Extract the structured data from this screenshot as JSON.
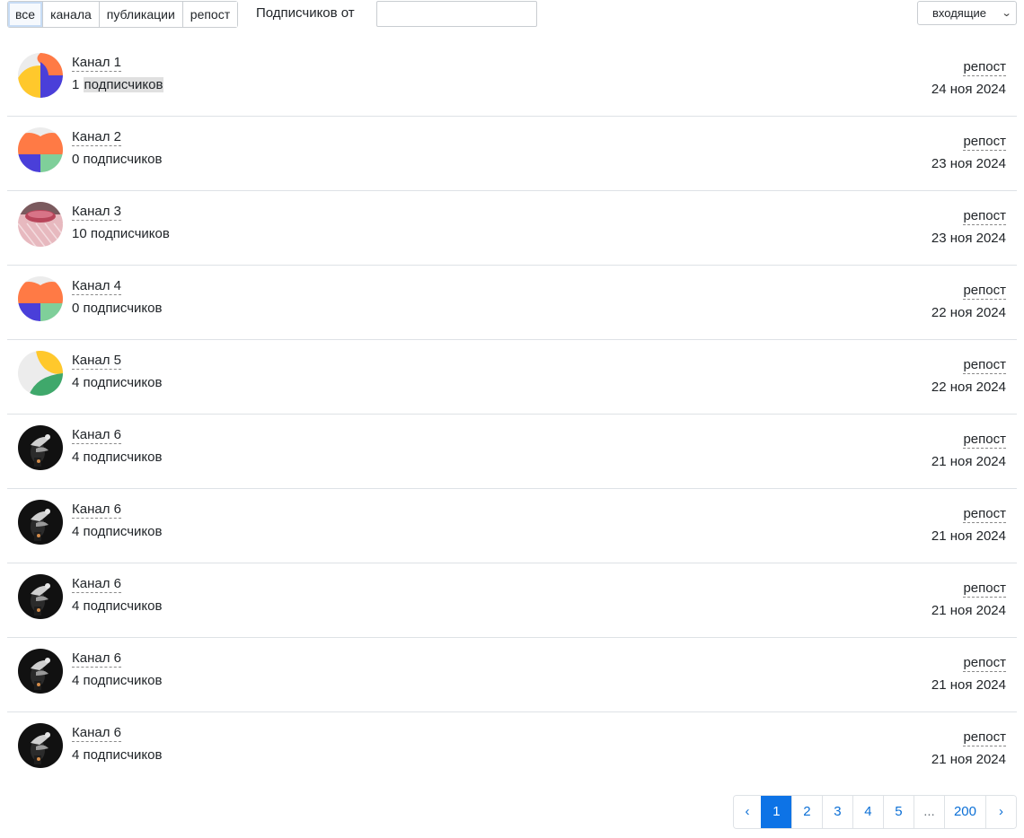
{
  "filters": {
    "tabs": [
      {
        "label": "все",
        "active": true
      },
      {
        "label": "канала",
        "active": false
      },
      {
        "label": "публикации",
        "active": false
      },
      {
        "label": "репост",
        "active": false
      }
    ],
    "subscribers_from_label": "Подписчиков от",
    "subscribers_from_value": "",
    "direction_select": {
      "selected": "входящие",
      "icon": "chevron-down-icon"
    }
  },
  "rows": [
    {
      "name": "Канал 1",
      "subscribers": "1",
      "subscribers_word": "подписчиков",
      "type": "репост",
      "date": "24 ноя 2024",
      "avatar": "avatar-orange-blue-yellow"
    },
    {
      "name": "Канал 2",
      "subscribers": "0",
      "subscribers_word": "подписчиков",
      "type": "репост",
      "date": "23 ноя 2024",
      "avatar": "avatar-orange-blue-green"
    },
    {
      "name": "Канал 3",
      "subscribers": "10",
      "subscribers_word": "подписчиков",
      "type": "репост",
      "date": "23 ноя 2024",
      "avatar": "avatar-photo-pink"
    },
    {
      "name": "Канал 4",
      "subscribers": "0",
      "subscribers_word": "подписчиков",
      "type": "репост",
      "date": "22 ноя 2024",
      "avatar": "avatar-orange-blue-green"
    },
    {
      "name": "Канал 5",
      "subscribers": "4",
      "subscribers_word": "подписчиков",
      "type": "репост",
      "date": "22 ноя 2024",
      "avatar": "avatar-yellow-green"
    },
    {
      "name": "Канал 6",
      "subscribers": "4",
      "subscribers_word": "подписчиков",
      "type": "репост",
      "date": "21 ноя 2024",
      "avatar": "avatar-photo-dark"
    },
    {
      "name": "Канал 6",
      "subscribers": "4",
      "subscribers_word": "подписчиков",
      "type": "репост",
      "date": "21 ноя 2024",
      "avatar": "avatar-photo-dark"
    },
    {
      "name": "Канал 6",
      "subscribers": "4",
      "subscribers_word": "подписчиков",
      "type": "репост",
      "date": "21 ноя 2024",
      "avatar": "avatar-photo-dark"
    },
    {
      "name": "Канал 6",
      "subscribers": "4",
      "subscribers_word": "подписчиков",
      "type": "репост",
      "date": "21 ноя 2024",
      "avatar": "avatar-photo-dark"
    },
    {
      "name": "Канал 6",
      "subscribers": "4",
      "subscribers_word": "подписчиков",
      "type": "репост",
      "date": "21 ноя 2024",
      "avatar": "avatar-photo-dark"
    }
  ],
  "pagination": {
    "prev": "‹",
    "pages": [
      "1",
      "2",
      "3",
      "4",
      "5",
      "...",
      "200"
    ],
    "current": "1",
    "next": "›"
  },
  "colors": {
    "accent": "#0d73e6",
    "border": "#dee2e6",
    "avatar_orange": "#ff7a45",
    "avatar_blue": "#4a3fd9",
    "avatar_yellow": "#ffc82c",
    "avatar_green": "#3fa86b",
    "avatar_light_green": "#7fcf9a"
  }
}
